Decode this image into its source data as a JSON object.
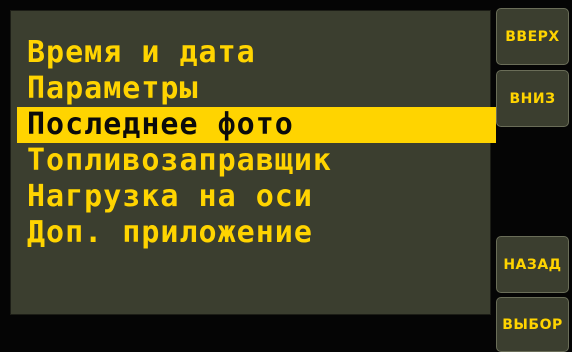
{
  "menu": {
    "items": [
      {
        "label": "Время и дата"
      },
      {
        "label": "Параметры"
      },
      {
        "label": "Последнее фото"
      },
      {
        "label": "Топливозаправщик"
      },
      {
        "label": "Нагрузка на оси"
      },
      {
        "label": "Доп. приложение"
      }
    ],
    "selected_index": 2
  },
  "side_buttons": {
    "up": "ВВЕРХ",
    "down": "ВНИЗ",
    "back": "НАЗАД",
    "select": "ВЫБОР"
  },
  "colors": {
    "accent": "#ffd400",
    "panel": "#3b3e2f",
    "background": "#050505"
  }
}
